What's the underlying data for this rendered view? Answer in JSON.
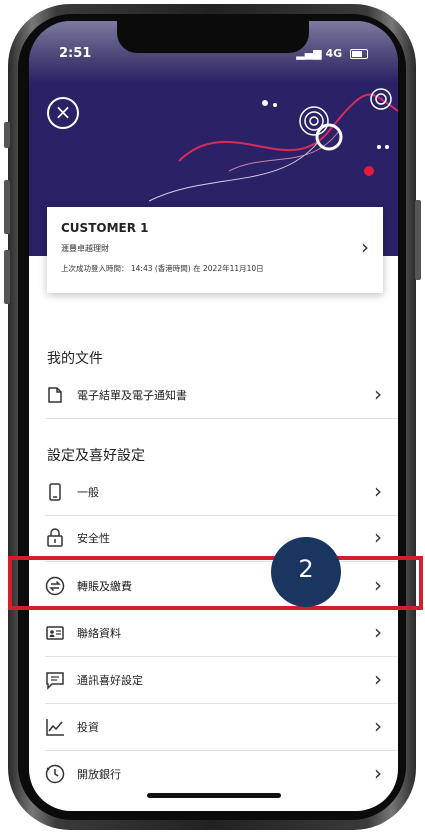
{
  "status_bar": {
    "time": "2:51",
    "network": "4G"
  },
  "account_card": {
    "name": "CUSTOMER 1",
    "tier": "滙豐卓越理財",
    "last_login": "上次成功登入時間： 14:43 (香港時間) 在 2022年11月10日"
  },
  "sections": {
    "my_documents": {
      "title": "我的文件",
      "items": [
        {
          "label": "電子結單及電子通知書",
          "icon": "document-icon"
        }
      ]
    },
    "settings": {
      "title": "設定及喜好設定",
      "items": [
        {
          "label": "一般",
          "icon": "phone-icon"
        },
        {
          "label": "安全性",
          "icon": "lock-icon"
        },
        {
          "label": "轉賬及繳費",
          "icon": "transfer-icon"
        },
        {
          "label": "聯絡資料",
          "icon": "contact-card-icon"
        },
        {
          "label": "通訊喜好設定",
          "icon": "message-icon"
        },
        {
          "label": "投資",
          "icon": "chart-icon"
        },
        {
          "label": "開放銀行",
          "icon": "open-banking-icon"
        }
      ]
    }
  },
  "annotation": {
    "step_number": "2"
  },
  "colors": {
    "hero": "#2b2166",
    "highlight": "#d21f2b",
    "badge": "#1b3561"
  }
}
